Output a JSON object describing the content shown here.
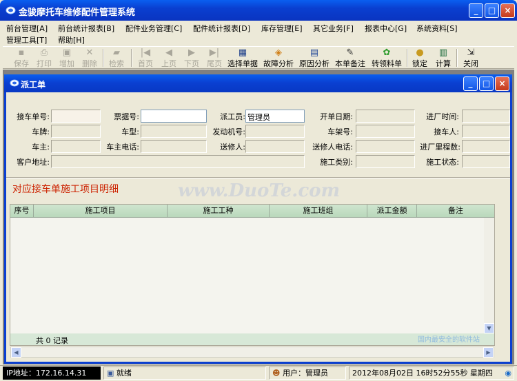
{
  "app": {
    "title": "金骏摩托车维修配件管理系统",
    "window_buttons": {
      "minimize": "_",
      "maximize": "□",
      "close": "×"
    }
  },
  "menu": [
    "前台管理[A]",
    "前台统计报表[B]",
    "配件业务管理[C]",
    "配件统计报表[D]",
    "库存管理[E]",
    "其它业务[F]",
    "报表中心[G]",
    "系统资料[S]",
    "管理工具[T]",
    "帮助[H]"
  ],
  "toolbar": [
    {
      "label": "保存",
      "icon": "save-icon",
      "glyph": "▪",
      "enabled": false
    },
    {
      "label": "打印",
      "icon": "print-icon",
      "glyph": "⎙",
      "enabled": false
    },
    {
      "label": "增加",
      "icon": "add-icon",
      "glyph": "▣",
      "enabled": false
    },
    {
      "label": "删除",
      "icon": "delete-icon",
      "glyph": "✕",
      "enabled": false
    },
    {
      "label": "检索",
      "icon": "search-icon",
      "glyph": "▰",
      "enabled": false
    },
    {
      "label": "首页",
      "icon": "first-page-icon",
      "glyph": "|◀",
      "enabled": false
    },
    {
      "label": "上页",
      "icon": "prev-page-icon",
      "glyph": "◀",
      "enabled": false
    },
    {
      "label": "下页",
      "icon": "next-page-icon",
      "glyph": "▶",
      "enabled": false
    },
    {
      "label": "尾页",
      "icon": "last-page-icon",
      "glyph": "▶|",
      "enabled": false
    },
    {
      "label": "选择单据",
      "icon": "select-document-icon",
      "glyph": "▦",
      "enabled": true
    },
    {
      "label": "故障分析",
      "icon": "fault-analysis-icon",
      "glyph": "◈",
      "enabled": true
    },
    {
      "label": "原因分析",
      "icon": "cause-analysis-icon",
      "glyph": "▤",
      "enabled": true
    },
    {
      "label": "本单备注",
      "icon": "note-icon",
      "glyph": "✎",
      "enabled": true
    },
    {
      "label": "转领料单",
      "icon": "transfer-icon",
      "glyph": "✿",
      "enabled": true
    },
    {
      "label": "锁定",
      "icon": "lock-icon",
      "glyph": "●",
      "enabled": true
    },
    {
      "label": "计算",
      "icon": "calculator-icon",
      "glyph": "▥",
      "enabled": true
    },
    {
      "label": "关闭",
      "icon": "close-door-icon",
      "glyph": "⇲",
      "enabled": true
    }
  ],
  "child_window": {
    "title": "派工单",
    "fields": {
      "row1": [
        {
          "label": "接车单号:",
          "value": ""
        },
        {
          "label": "票据号:",
          "value": ""
        },
        {
          "label": "派工员:",
          "value": "管理员"
        },
        {
          "label": "开单日期:",
          "value": ""
        },
        {
          "label": "进厂时间:",
          "value": ""
        }
      ],
      "row2": [
        {
          "label": "车牌:",
          "value": ""
        },
        {
          "label": "车型:",
          "value": ""
        },
        {
          "label": "发动机号:",
          "value": ""
        },
        {
          "label": "车架号:",
          "value": ""
        },
        {
          "label": "接车人:",
          "value": ""
        }
      ],
      "row3": [
        {
          "label": "车主:",
          "value": ""
        },
        {
          "label": "车主电话:",
          "value": ""
        },
        {
          "label": "送修人:",
          "value": ""
        },
        {
          "label": "送修人电话:",
          "value": ""
        },
        {
          "label": "进厂里程数:",
          "value": ""
        }
      ],
      "row4": [
        {
          "label": "客户地址:",
          "value": ""
        },
        {
          "label": "施工类别:",
          "value": ""
        },
        {
          "label": "施工状态:",
          "value": ""
        }
      ]
    },
    "section_title": "对应接车单施工项目明细",
    "grid": {
      "columns": [
        "序号",
        "施工项目",
        "施工工种",
        "施工班组",
        "派工金额",
        "备注"
      ],
      "rows": [],
      "footer": "共 0 记录"
    }
  },
  "watermark": "www.DuoTe.com",
  "watermark2": "国内最安全的软件站",
  "status": {
    "ip": "IP地址：172.16.14.31",
    "ready": "就绪",
    "user": "用户：管理员",
    "datetime": "2012年08月02日   16时52分55秒  星期四"
  }
}
